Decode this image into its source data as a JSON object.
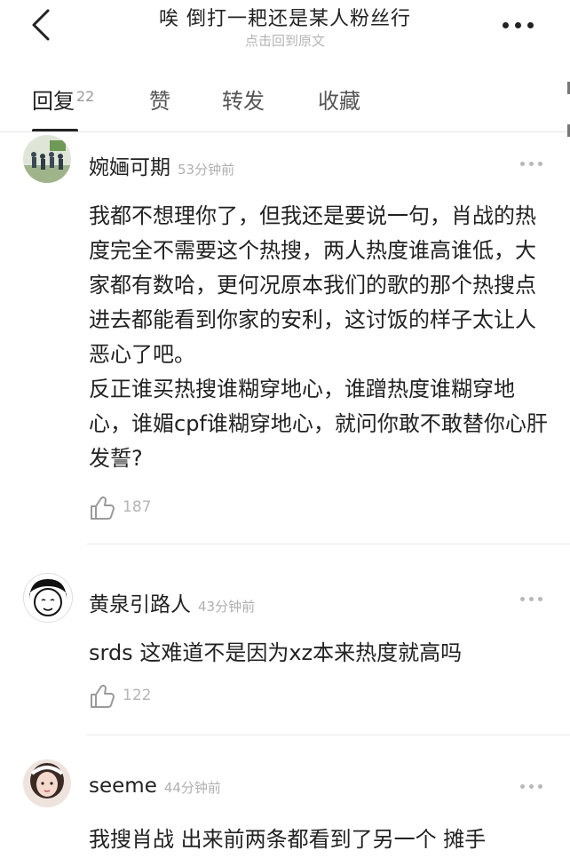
{
  "header": {
    "title": "唉 倒打一耙还是某人粉丝行",
    "subtitle": "点击回到原文"
  },
  "tabs": [
    {
      "label": "回复",
      "count": "22"
    },
    {
      "label": "赞"
    },
    {
      "label": "转发"
    },
    {
      "label": "收藏"
    }
  ],
  "comments": [
    {
      "author": "婉婳可期",
      "time": "53分钟前",
      "content": "我都不想理你了，但我还是要说一句，肖战的热度完全不需要这个热搜，两人热度谁高谁低，大家都有数哈，更何况原本我们的歌的那个热搜点进去都能看到你家的安利，这讨饭的样子太让人恶心了吧。\n反正谁买热搜谁糊穿地心，谁蹭热度谁糊穿地心，谁媚cpf谁糊穿地心，就问你敢不敢替你心肝发誓?",
      "likes": "187"
    },
    {
      "author": "黄泉引路人",
      "time": "43分钟前",
      "content": "srds 这难道不是因为xz本来热度就高吗",
      "likes": "122"
    },
    {
      "author": "seeme",
      "time": "44分钟前",
      "content": "我搜肖战 出来前两条都看到了另一个 摊手"
    }
  ],
  "colors": {
    "text": "#222222",
    "muted": "#b0b0b0",
    "divider": "#e8e8e8"
  }
}
